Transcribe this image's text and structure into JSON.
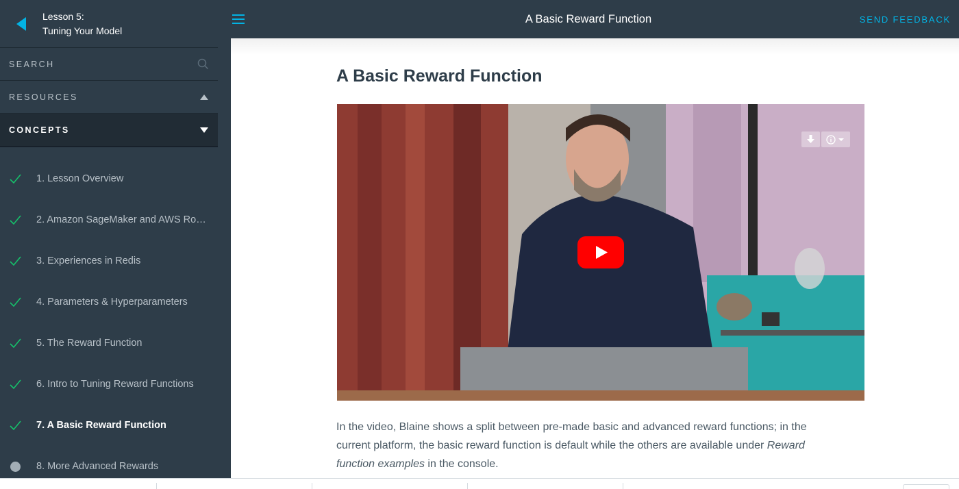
{
  "sidebar": {
    "lesson_line1": "Lesson 5:",
    "lesson_line2": "Tuning Your Model",
    "search_label": "SEARCH",
    "resources_label": "RESOURCES",
    "concepts_label": "CONCEPTS",
    "concepts": [
      {
        "label": "1. Lesson Overview",
        "status": "complete"
      },
      {
        "label": "2. Amazon SageMaker and AWS Rob...",
        "status": "complete"
      },
      {
        "label": "3. Experiences in Redis",
        "status": "complete"
      },
      {
        "label": "4. Parameters & Hyperparameters",
        "status": "complete"
      },
      {
        "label": "5. The Reward Function",
        "status": "complete"
      },
      {
        "label": "6. Intro to Tuning Reward Functions",
        "status": "complete"
      },
      {
        "label": "7. A Basic Reward Function",
        "status": "complete-current"
      },
      {
        "label": "8. More Advanced Rewards",
        "status": "incomplete"
      }
    ]
  },
  "topbar": {
    "title": "A Basic Reward Function",
    "feedback_label": "SEND FEEDBACK"
  },
  "main": {
    "title": "A Basic Reward Function",
    "paragraph_part1": "In the video, Blaine shows a split between pre-made basic and advanced reward functions; in the current platform, the basic reward function is default while the others are available under ",
    "paragraph_em": "Reward function examples",
    "paragraph_part2": " in the console."
  },
  "colors": {
    "sidebar_bg": "#2e3d49",
    "accent": "#02b3e4",
    "check": "#15c26b",
    "youtube_red": "#ff0000"
  },
  "icons": {
    "back": "back-arrow-icon",
    "search": "search-icon",
    "resources": "caret-up-icon",
    "concepts": "caret-down-icon",
    "menu": "hamburger-menu-icon",
    "check": "check-icon",
    "play": "play-icon",
    "download": "download-icon",
    "info": "info-icon"
  }
}
